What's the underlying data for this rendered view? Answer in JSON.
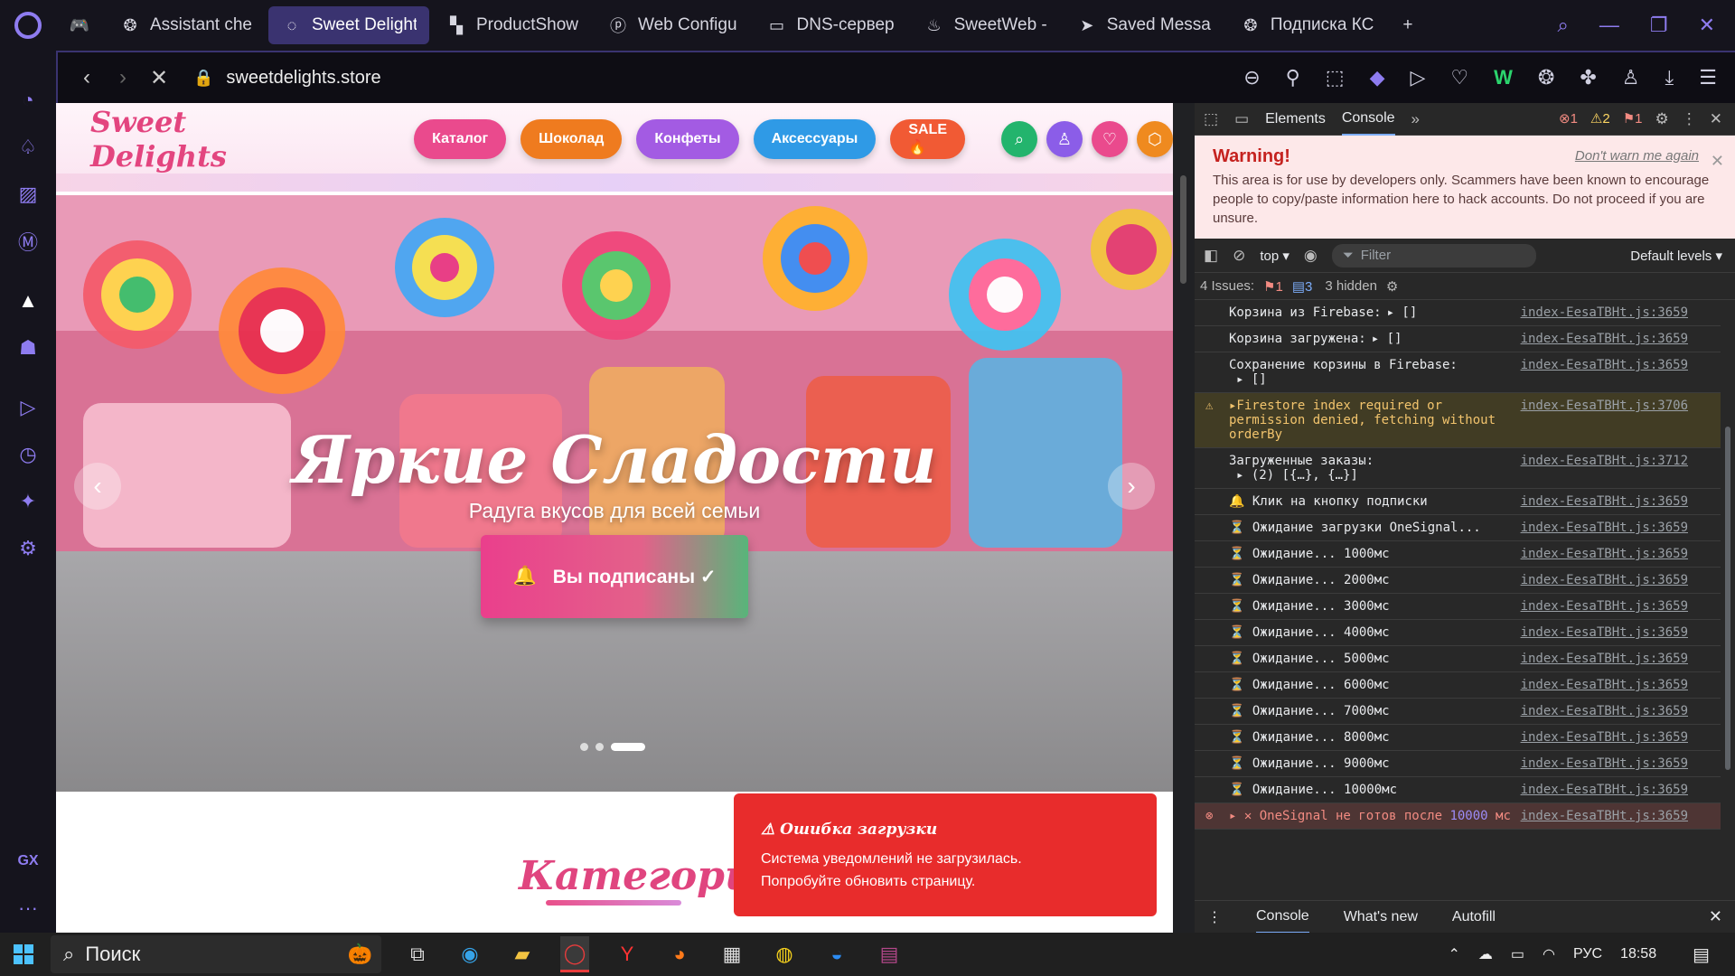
{
  "tabs": [
    {
      "icon": "gamepad-icon",
      "label": "",
      "active": false
    },
    {
      "icon": "openai-icon",
      "label": "Assistant che",
      "active": false
    },
    {
      "icon": "spinner-icon",
      "label": "Sweet Delights - Мараз",
      "active": true
    },
    {
      "icon": "productshow-icon",
      "label": "ProductShow",
      "active": false
    },
    {
      "icon": "pinterest-icon",
      "label": "Web Configu",
      "active": false
    },
    {
      "icon": "folder-icon",
      "label": "DNS-сервер",
      "active": false
    },
    {
      "icon": "firebase-icon",
      "label": "SweetWeb -",
      "active": false
    },
    {
      "icon": "telegram-icon",
      "label": "Saved Messa",
      "active": false
    },
    {
      "icon": "openai-icon",
      "label": "Подписка КС",
      "active": false
    }
  ],
  "address": {
    "url": "sweetdelights.store"
  },
  "site": {
    "brand": "Sweet Delights",
    "menu": [
      {
        "label": "Каталог",
        "color": "#ea4a8d"
      },
      {
        "label": "Шоколад",
        "color": "#ef7b1f"
      },
      {
        "label": "Конфеты",
        "color": "#a35be3"
      },
      {
        "label": "Аксессуары",
        "color": "#2f9ae6"
      },
      {
        "label": "SALE 🔥",
        "color": "#f15a34"
      }
    ],
    "hero_title": "Яркие Сладости",
    "hero_subtitle": "Радуга вкусов для всей семьи",
    "subscribe_label": "Вы подписаны ✓",
    "categories_title": "Категории",
    "slide_count": 3,
    "active_slide": 3
  },
  "toast": {
    "title": "⚠ Ошибка загрузки",
    "line1": "Система уведомлений не загрузилась.",
    "line2": "Попробуйте обновить страницу."
  },
  "devtools": {
    "tabs": [
      "Elements",
      "Console"
    ],
    "counts": {
      "errors": "1",
      "warnings": "2",
      "info": "1"
    },
    "warning_title": "Warning!",
    "dont_warn": "Don't warn me again",
    "warning_text": "This area is for use by developers only. Scammers have been known to encourage people to copy/paste information here to hack accounts. Do not proceed if you are unsure.",
    "context": "top",
    "filter_placeholder": "Filter",
    "levels": "Default levels",
    "issues_label": "4 Issues:",
    "issues_err": "1",
    "issues_info": "3",
    "hidden": "3 hidden",
    "logs": [
      {
        "type": "log",
        "text": "Корзина из Firebase:",
        "sub": "▸ []",
        "src": "index-EesaTBHt.js:3659",
        "inline": true
      },
      {
        "type": "log",
        "text": "Корзина загружена:",
        "sub": "▸ []",
        "src": "index-EesaTBHt.js:3659",
        "inline": true
      },
      {
        "type": "log",
        "text": "Сохранение корзины в Firebase:",
        "sub": "▸ []",
        "src": "index-EesaTBHt.js:3659",
        "inline": false
      },
      {
        "type": "warn",
        "text": "▸Firestore index required or permission denied, fetching without orderBy",
        "sub": "",
        "src": "index-EesaTBHt.js:3706",
        "inline": false
      },
      {
        "type": "log",
        "text": "Загруженные заказы:",
        "sub": "▸ (2) [{…}, {…}]",
        "src": "index-EesaTBHt.js:3712",
        "inline": false
      },
      {
        "type": "log",
        "icon": "🔔",
        "text": "Клик на кнопку подписки",
        "sub": "",
        "src": "index-EesaTBHt.js:3659",
        "inline": false
      },
      {
        "type": "log",
        "icon": "⏳",
        "text": "Ожидание загрузки OneSignal...",
        "sub": "",
        "src": "index-EesaTBHt.js:3659",
        "inline": false
      },
      {
        "type": "log",
        "icon": "⏳",
        "text": "Ожидание... 1000мс",
        "sub": "",
        "src": "index-EesaTBHt.js:3659",
        "inline": false
      },
      {
        "type": "log",
        "icon": "⏳",
        "text": "Ожидание... 2000мс",
        "sub": "",
        "src": "index-EesaTBHt.js:3659",
        "inline": false
      },
      {
        "type": "log",
        "icon": "⏳",
        "text": "Ожидание... 3000мс",
        "sub": "",
        "src": "index-EesaTBHt.js:3659",
        "inline": false
      },
      {
        "type": "log",
        "icon": "⏳",
        "text": "Ожидание... 4000мс",
        "sub": "",
        "src": "index-EesaTBHt.js:3659",
        "inline": false
      },
      {
        "type": "log",
        "icon": "⏳",
        "text": "Ожидание... 5000мс",
        "sub": "",
        "src": "index-EesaTBHt.js:3659",
        "inline": false
      },
      {
        "type": "log",
        "icon": "⏳",
        "text": "Ожидание... 6000мс",
        "sub": "",
        "src": "index-EesaTBHt.js:3659",
        "inline": false
      },
      {
        "type": "log",
        "icon": "⏳",
        "text": "Ожидание... 7000мс",
        "sub": "",
        "src": "index-EesaTBHt.js:3659",
        "inline": false
      },
      {
        "type": "log",
        "icon": "⏳",
        "text": "Ожидание... 8000мс",
        "sub": "",
        "src": "index-EesaTBHt.js:3659",
        "inline": false
      },
      {
        "type": "log",
        "icon": "⏳",
        "text": "Ожидание... 9000мс",
        "sub": "",
        "src": "index-EesaTBHt.js:3659",
        "inline": false
      },
      {
        "type": "log",
        "icon": "⏳",
        "text": "Ожидание... 10000мс",
        "sub": "",
        "src": "index-EesaTBHt.js:3659",
        "inline": false
      }
    ],
    "error_text": "OneSignal не готов после",
    "error_num": "10000",
    "error_unit": "мс",
    "error_src": "index-EesaTBHt.js:3659",
    "drawer_tabs": [
      "Console",
      "What's new",
      "Autofill"
    ]
  },
  "taskbar": {
    "search_label": "Поиск",
    "lang": "РУС",
    "time": "18:58"
  }
}
